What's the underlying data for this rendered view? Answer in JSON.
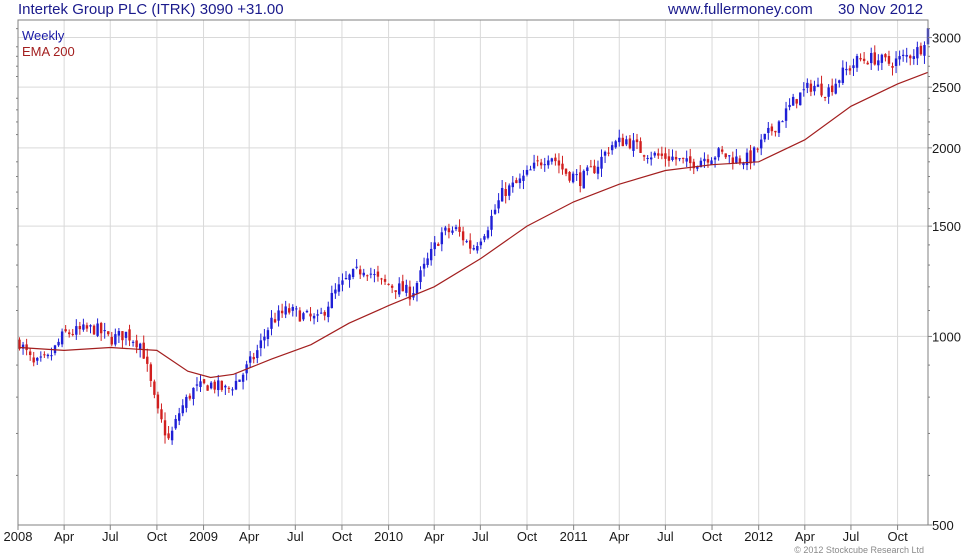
{
  "header": {
    "title": "Intertek Group PLC (ITRK) 3090",
    "change": "+31.00",
    "site": "www.fullermoney.com",
    "date": "30 Nov 2012"
  },
  "legend": {
    "series1": "Weekly",
    "series2": "EMA 200"
  },
  "copyright": "© 2012 Stockcube Research Ltd",
  "colors": {
    "up": "#1f1fd6",
    "down": "#d11f1f",
    "ema": "#a31f1f",
    "grid": "#d9d9d9",
    "text": "#1a1a8c"
  },
  "chart_data": {
    "type": "candlestick",
    "yscale": "log",
    "ylim": [
      500,
      3200
    ],
    "yticks": [
      500,
      1000,
      1500,
      2000,
      2500,
      3000
    ],
    "ytick_labels": [
      "500",
      "1000",
      "1500",
      "2000",
      "2500",
      "3000"
    ],
    "xlim": [
      "2008-01-01",
      "2012-11-30"
    ],
    "xticks": [
      "2008-01-01",
      "2008-04-01",
      "2008-07-01",
      "2008-10-01",
      "2009-01-01",
      "2009-04-01",
      "2009-07-01",
      "2009-10-01",
      "2010-01-01",
      "2010-04-01",
      "2010-07-01",
      "2010-10-01",
      "2011-01-01",
      "2011-04-01",
      "2011-07-01",
      "2011-10-01",
      "2012-01-01",
      "2012-04-01",
      "2012-07-01",
      "2012-10-01"
    ],
    "xtick_labels": [
      "2008",
      "Apr",
      "Jul",
      "Oct",
      "2009",
      "Apr",
      "Jul",
      "Oct",
      "2010",
      "Apr",
      "Jul",
      "Oct",
      "2011",
      "Apr",
      "Jul",
      "Oct",
      "2012",
      "Apr",
      "Jul",
      "Oct"
    ],
    "series": [
      {
        "name": "Weekly",
        "kind": "close_path",
        "points": [
          [
            "2008-01-04",
            980
          ],
          [
            "2008-02-01",
            900
          ],
          [
            "2008-03-01",
            920
          ],
          [
            "2008-04-01",
            1010
          ],
          [
            "2008-05-01",
            1020
          ],
          [
            "2008-06-01",
            1030
          ],
          [
            "2008-07-01",
            990
          ],
          [
            "2008-08-01",
            1010
          ],
          [
            "2008-09-01",
            970
          ],
          [
            "2008-10-01",
            760
          ],
          [
            "2008-10-25",
            680
          ],
          [
            "2008-11-15",
            760
          ],
          [
            "2008-12-10",
            820
          ],
          [
            "2009-01-15",
            840
          ],
          [
            "2009-02-15",
            820
          ],
          [
            "2009-03-15",
            860
          ],
          [
            "2009-04-15",
            940
          ],
          [
            "2009-05-15",
            1060
          ],
          [
            "2009-06-15",
            1100
          ],
          [
            "2009-07-15",
            1080
          ],
          [
            "2009-08-15",
            1060
          ],
          [
            "2009-09-15",
            1170
          ],
          [
            "2009-10-15",
            1240
          ],
          [
            "2009-11-15",
            1290
          ],
          [
            "2009-12-15",
            1220
          ],
          [
            "2010-01-15",
            1200
          ],
          [
            "2010-02-15",
            1170
          ],
          [
            "2010-03-15",
            1300
          ],
          [
            "2010-04-15",
            1460
          ],
          [
            "2010-05-15",
            1480
          ],
          [
            "2010-06-15",
            1380
          ],
          [
            "2010-07-15",
            1500
          ],
          [
            "2010-08-15",
            1700
          ],
          [
            "2010-09-15",
            1760
          ],
          [
            "2010-10-15",
            1860
          ],
          [
            "2010-11-15",
            1960
          ],
          [
            "2010-12-15",
            1830
          ],
          [
            "2011-01-15",
            1780
          ],
          [
            "2011-02-15",
            1870
          ],
          [
            "2011-03-15",
            2020
          ],
          [
            "2011-04-15",
            2060
          ],
          [
            "2011-05-15",
            1980
          ],
          [
            "2011-06-15",
            1940
          ],
          [
            "2011-07-15",
            1930
          ],
          [
            "2011-08-15",
            1880
          ],
          [
            "2011-09-15",
            1930
          ],
          [
            "2011-10-15",
            1960
          ],
          [
            "2011-11-15",
            1920
          ],
          [
            "2011-12-15",
            1920
          ],
          [
            "2012-01-15",
            2080
          ],
          [
            "2012-02-15",
            2230
          ],
          [
            "2012-03-15",
            2400
          ],
          [
            "2012-04-15",
            2520
          ],
          [
            "2012-05-15",
            2460
          ],
          [
            "2012-06-15",
            2630
          ],
          [
            "2012-07-15",
            2760
          ],
          [
            "2012-08-15",
            2780
          ],
          [
            "2012-09-15",
            2730
          ],
          [
            "2012-10-15",
            2790
          ],
          [
            "2012-11-15",
            2880
          ],
          [
            "2012-11-30",
            3090
          ]
        ]
      },
      {
        "name": "EMA 200",
        "kind": "line",
        "points": [
          [
            "2008-01-04",
            960
          ],
          [
            "2008-04-01",
            950
          ],
          [
            "2008-07-01",
            960
          ],
          [
            "2008-10-01",
            950
          ],
          [
            "2008-12-01",
            880
          ],
          [
            "2009-01-15",
            860
          ],
          [
            "2009-03-01",
            870
          ],
          [
            "2009-05-15",
            920
          ],
          [
            "2009-08-01",
            970
          ],
          [
            "2009-10-15",
            1050
          ],
          [
            "2010-01-01",
            1120
          ],
          [
            "2010-04-01",
            1200
          ],
          [
            "2010-07-01",
            1330
          ],
          [
            "2010-10-01",
            1500
          ],
          [
            "2011-01-01",
            1640
          ],
          [
            "2011-04-01",
            1750
          ],
          [
            "2011-07-01",
            1840
          ],
          [
            "2011-10-01",
            1880
          ],
          [
            "2012-01-01",
            1900
          ],
          [
            "2012-04-01",
            2060
          ],
          [
            "2012-07-01",
            2330
          ],
          [
            "2012-10-01",
            2530
          ],
          [
            "2012-11-30",
            2640
          ]
        ]
      }
    ]
  }
}
